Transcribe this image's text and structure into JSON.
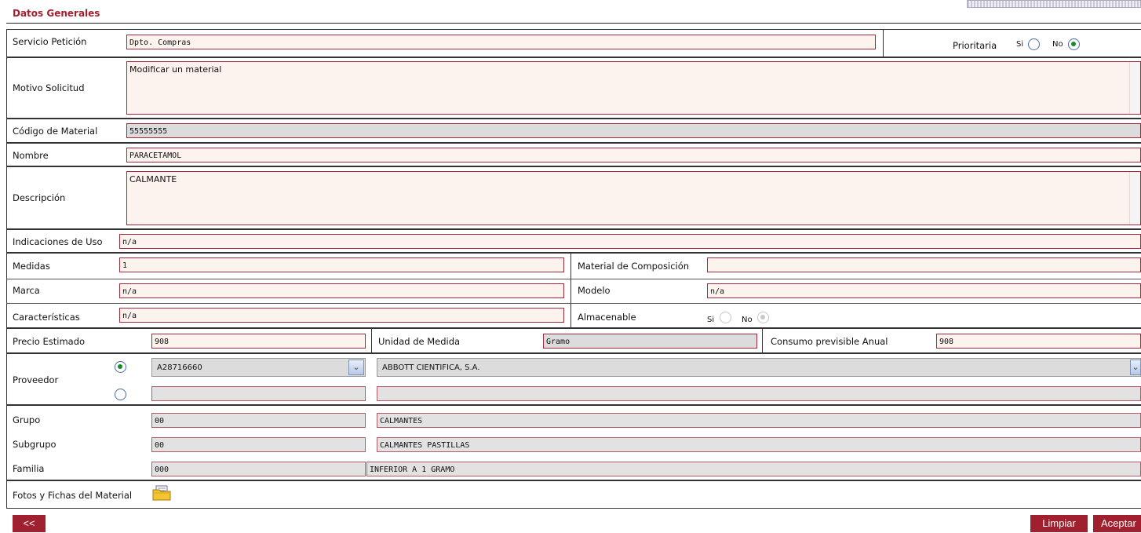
{
  "section": {
    "title": "Datos Generales"
  },
  "servicio": {
    "label": "Servicio Petición",
    "value": "Dpto. Compras"
  },
  "prioritaria": {
    "label": "Prioritaria",
    "si": "Si",
    "no": "No",
    "selected": "No"
  },
  "motivo": {
    "label": "Motivo Solicitud",
    "value": "Modificar un material"
  },
  "codigo": {
    "label": "Código de Material",
    "value": "55555555"
  },
  "nombre": {
    "label": "Nombre",
    "value": "PARACETAMOL"
  },
  "descripcion": {
    "label": "Descripción",
    "value": "CALMANTE"
  },
  "indicaciones": {
    "label": "Indicaciones de Uso",
    "value": "n/a"
  },
  "medidas": {
    "label": "Medidas",
    "value": "1"
  },
  "material_comp": {
    "label": "Material de Composición",
    "value": ""
  },
  "marca": {
    "label": "Marca",
    "value": "n/a"
  },
  "modelo": {
    "label": "Modelo",
    "value": "n/a"
  },
  "caracteristicas": {
    "label": "Características",
    "value": "n/a"
  },
  "almacenable": {
    "label": "Almacenable",
    "si": "Si",
    "no": "No",
    "selected": "No"
  },
  "precio": {
    "label": "Precio Estimado",
    "value": "908"
  },
  "unidad": {
    "label": "Unidad de Medida",
    "value": "Gramo"
  },
  "consumo": {
    "label": "Consumo previsible Anual",
    "value": "908"
  },
  "proveedor": {
    "label": "Proveedor",
    "selected_option": 1,
    "code": "A28716660",
    "name": "ABBOTT CIENTIFICA, S.A.",
    "code2": "",
    "name2": ""
  },
  "grupo": {
    "label": "Grupo",
    "code": "00",
    "name": "CALMANTES"
  },
  "subgrupo": {
    "label": "Subgrupo",
    "code": "00",
    "name": "CALMANTES PASTILLAS"
  },
  "familia": {
    "label": "Familia",
    "code": "000",
    "name": "INFERIOR A 1 GRAMO"
  },
  "fotos": {
    "label": "Fotos y Fichas del Material",
    "icon": "folder-icon"
  },
  "buttons": {
    "back": "<<",
    "limpiar": "Limpiar",
    "aceptar": "Aceptar"
  }
}
